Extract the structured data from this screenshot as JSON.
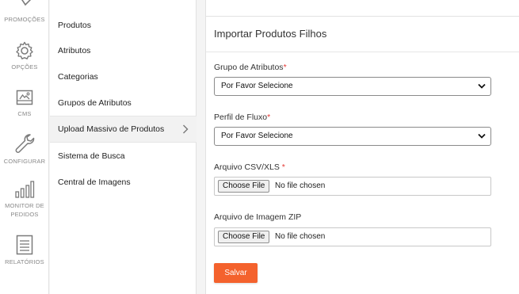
{
  "rail": {
    "items": [
      {
        "label": "PROMOÇÕES",
        "icon": "tag-icon"
      },
      {
        "label": "OPÇÕES",
        "icon": "gear-icon"
      },
      {
        "label": "CMS",
        "icon": "cms-image-icon"
      },
      {
        "label": "CONFIGURAR",
        "icon": "wrench-icon"
      },
      {
        "label": "MONITOR DE",
        "label2": "PEDIDOS",
        "icon": "bar-chart-icon"
      },
      {
        "label": "RELATÓRIOS",
        "icon": "report-list-icon"
      }
    ]
  },
  "submenu": {
    "items": [
      {
        "label": "Produtos"
      },
      {
        "label": "Atributos"
      },
      {
        "label": "Categorias"
      },
      {
        "label": "Grupos de Atributos"
      },
      {
        "label": "Upload Massivo de Produtos",
        "active": true
      },
      {
        "label": "Sistema de Busca"
      },
      {
        "label": "Central de Imagens"
      }
    ]
  },
  "main": {
    "title": "Importar Produtos Filhos",
    "fields": {
      "attribute_group": {
        "label": "Grupo de Atributos",
        "required_mark": "*",
        "value": "Por Favor Selecione"
      },
      "workflow_profile": {
        "label": "Perfil de Fluxo",
        "required_mark": "*",
        "value": "Por Favor Selecione"
      },
      "csv_file": {
        "label": "Arquivo CSV/XLS ",
        "required_mark": "*",
        "button": "Choose File",
        "status": "No file chosen"
      },
      "image_zip": {
        "label": "Arquivo de Imagem ZIP",
        "button": "Choose File",
        "status": "No file chosen"
      }
    },
    "save_label": "Salvar"
  },
  "colors": {
    "accent": "#f4622d",
    "required": "#e53935",
    "icon_gray": "#7a7a7a"
  }
}
